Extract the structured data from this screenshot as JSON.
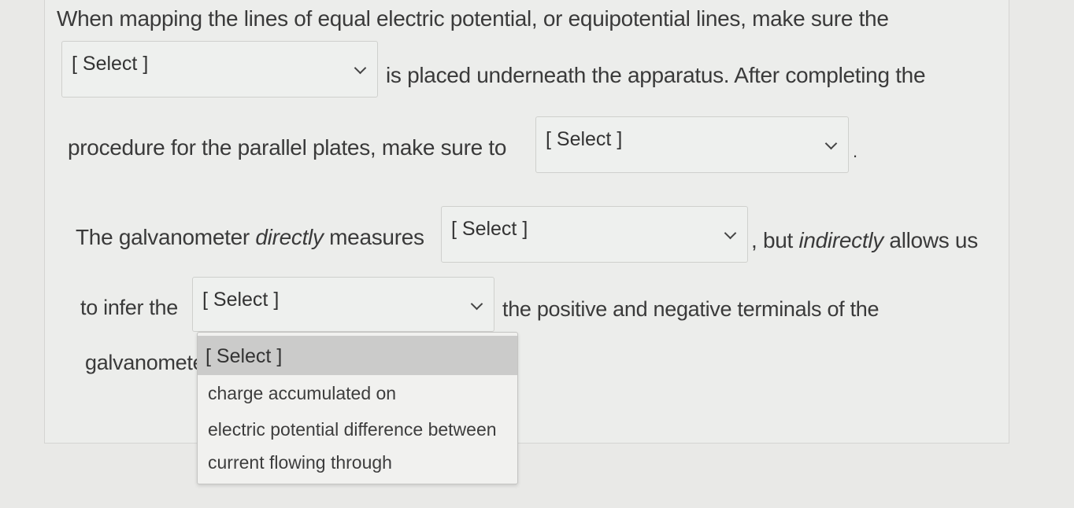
{
  "paragraph1": {
    "line1": "When mapping the lines of equal electric potential, or equipotential lines, make sure the",
    "line2": "is placed underneath the apparatus. After completing the",
    "line3": "procedure for the parallel plates, make sure to",
    "period": "."
  },
  "paragraph2": {
    "prefix_text": "The galvanometer ",
    "prefix_em": "directly",
    "prefix_tail": " measures",
    "mid_text": ", but ",
    "mid_em": "indirectly",
    "mid_tail": " allows us",
    "line2_start": "to infer the",
    "line2_end": "the positive and negative terminals of the",
    "line3_start": "galvanometer"
  },
  "selects": {
    "select1": "[ Select ]",
    "select2": "[ Select ]",
    "select3": "[ Select ]",
    "select4": "[ Select ]"
  },
  "dropdown": {
    "options": [
      "[ Select ]",
      "charge accumulated on",
      "electric potential difference between",
      "current flowing through"
    ]
  }
}
